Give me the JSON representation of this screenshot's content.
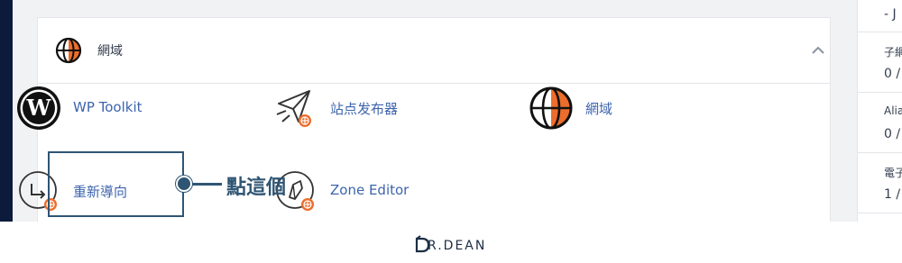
{
  "colors": {
    "nav": "#0c1a3b",
    "link": "#3d64ad",
    "accent_orange": "#ec6d2c",
    "callout": "#2f5573"
  },
  "domains_section": {
    "title": "網域",
    "header_icon": "globe-icon",
    "collapse_icon": "chevron-up-icon"
  },
  "tools": [
    {
      "label": "WP Toolkit",
      "icon": "wordpress-icon"
    },
    {
      "label": "站点发布器",
      "icon": "site-publisher-icon"
    },
    {
      "label": "網域",
      "icon": "globe-icon"
    },
    {
      "label": "重新導向",
      "icon": "redirect-icon"
    },
    {
      "label": "Zone Editor",
      "icon": "zone-editor-icon"
    }
  ],
  "callout": {
    "text": "點這個"
  },
  "stats": {
    "top_value": "- J",
    "items": [
      {
        "label": "子網",
        "value": "0 /"
      },
      {
        "label": "Alia",
        "value": "0 /"
      },
      {
        "label": "電子",
        "value": "1 /"
      }
    ]
  },
  "brand": {
    "text": "R.DEAN"
  }
}
